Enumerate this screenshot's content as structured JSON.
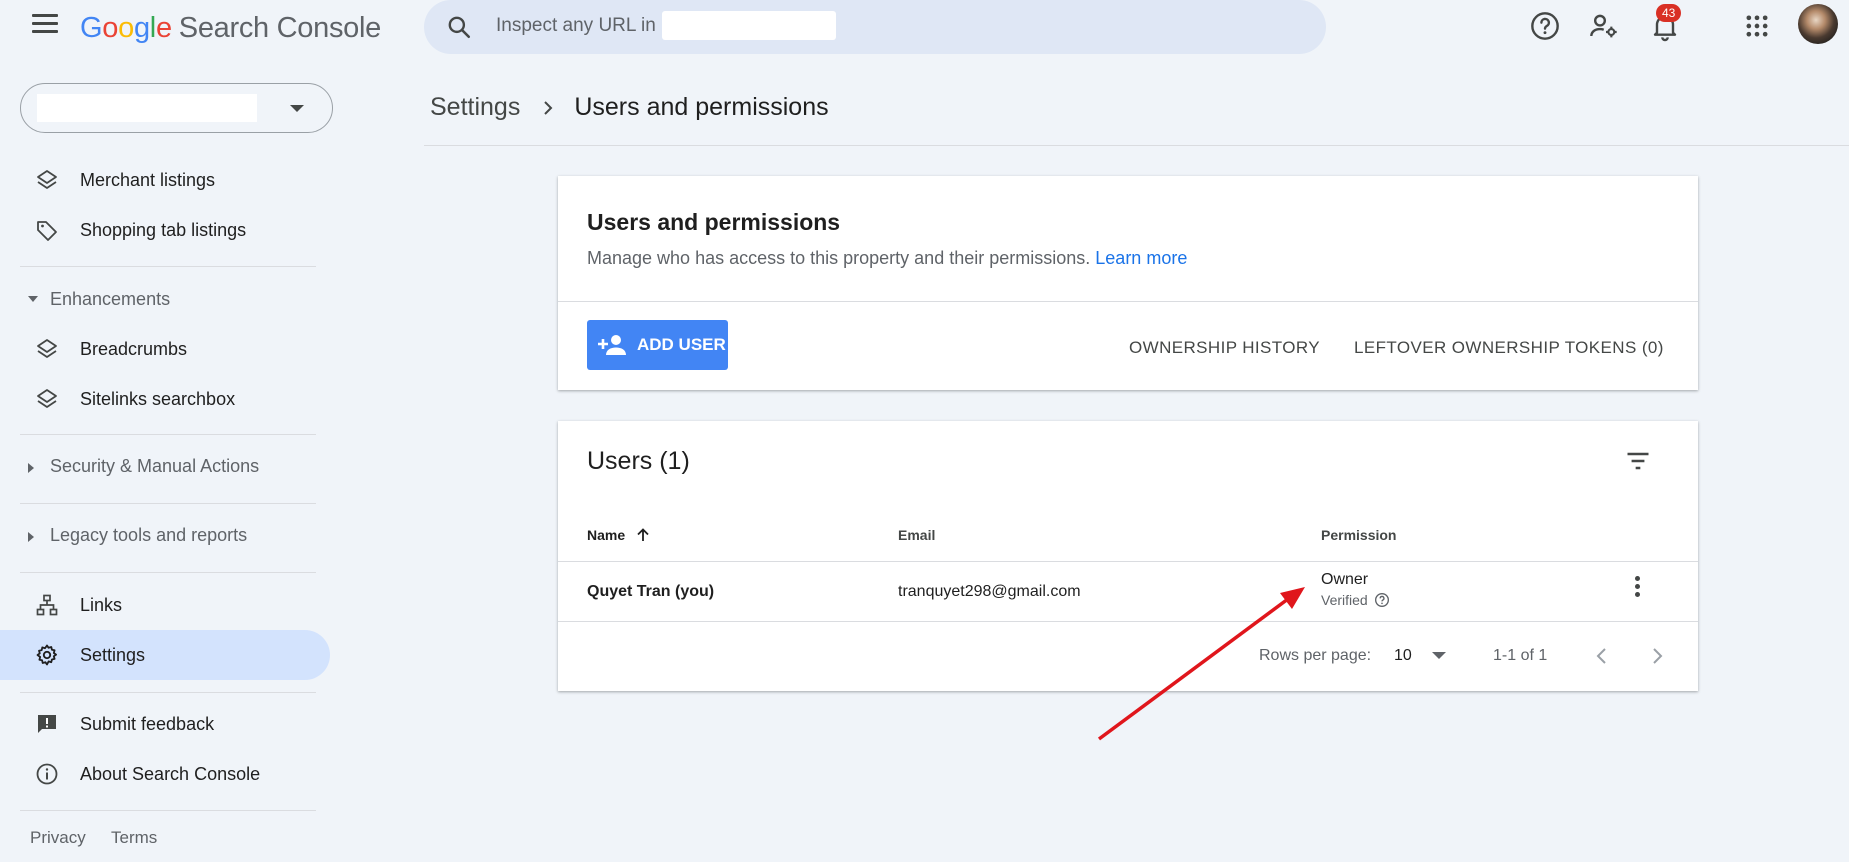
{
  "header": {
    "app_name_google": [
      "G",
      "o",
      "o",
      "g",
      "l",
      "e"
    ],
    "app_name_suffix": "Search Console",
    "search_placeholder": "Inspect any URL in",
    "notification_count": "43"
  },
  "sidebar": {
    "items_top": [
      {
        "label": "Merchant listings",
        "icon": "layers-icon"
      },
      {
        "label": "Shopping tab listings",
        "icon": "tag-icon"
      }
    ],
    "enhancements_label": "Enhancements",
    "enhancement_items": [
      {
        "label": "Breadcrumbs",
        "icon": "layers-icon"
      },
      {
        "label": "Sitelinks searchbox",
        "icon": "layers-icon"
      }
    ],
    "security_label": "Security & Manual Actions",
    "legacy_label": "Legacy tools and reports",
    "links_label": "Links",
    "settings_label": "Settings",
    "feedback_label": "Submit feedback",
    "about_label": "About Search Console",
    "privacy_label": "Privacy",
    "terms_label": "Terms"
  },
  "breadcrumb": {
    "parent": "Settings",
    "current": "Users and permissions"
  },
  "permissions_card": {
    "title": "Users and permissions",
    "description": "Manage who has access to this property and their permissions.",
    "learn_more": "Learn more",
    "add_user": "ADD USER",
    "ownership_history": "OWNERSHIP HISTORY",
    "leftover_tokens": "LEFTOVER OWNERSHIP TOKENS (0)"
  },
  "users_card": {
    "title": "Users (1)",
    "columns": {
      "name": "Name",
      "email": "Email",
      "permission": "Permission"
    },
    "rows": [
      {
        "name": "Quyet Tran (you)",
        "email": "tranquyet298@gmail.com",
        "permission": "Owner",
        "status": "Verified"
      }
    ],
    "rows_per_page_label": "Rows per page:",
    "rows_per_page_value": "10",
    "range": "1-1 of 1"
  },
  "colors": {
    "accent": "#4285f4",
    "active_nav": "#d3e3fd",
    "background": "#f0f4f9",
    "annotation_arrow": "#e0161c",
    "badge": "#d93025"
  }
}
